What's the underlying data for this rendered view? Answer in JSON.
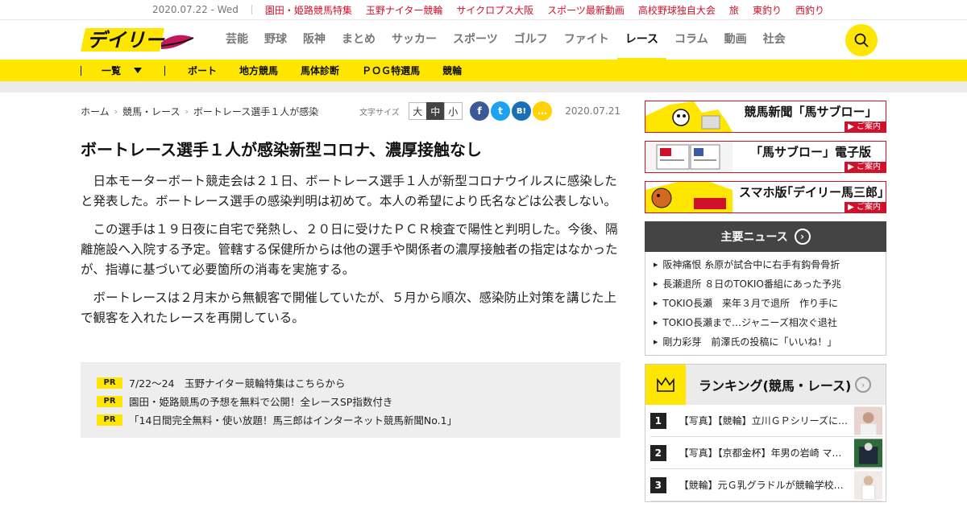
{
  "topbar": {
    "date": "2020.07.22 - Wed",
    "links": [
      "園田・姫路競馬特集",
      "玉野ナイター競輪",
      "サイクロプス大阪",
      "スポーツ最新動画",
      "高校野球独自大会",
      "旅",
      "東釣り",
      "西釣り"
    ]
  },
  "header": {
    "logo_text": "デイリー",
    "nav": [
      "芸能",
      "野球",
      "阪神",
      "まとめ",
      "サッカー",
      "スポーツ",
      "ゴルフ",
      "ファイト",
      "レース",
      "コラム",
      "動画",
      "社会"
    ],
    "active_nav": "レース"
  },
  "subnav": {
    "all_label": "一覧",
    "items": [
      "ボート",
      "地方競馬",
      "馬体診断",
      "ＰＯＧ特選馬",
      "競輪"
    ]
  },
  "breadcrumb": [
    "ホーム",
    "競馬・レース",
    "ボートレース選手１人が感染"
  ],
  "fontsize": {
    "label": "文字サイズ",
    "options": [
      "大",
      "中",
      "小"
    ],
    "selected": "中"
  },
  "share": {
    "facebook": "f",
    "twitter": "t",
    "hatena": "B!",
    "line": "…"
  },
  "article": {
    "date": "2020.07.21",
    "title": "ボートレース選手１人が感染新型コロナ、濃厚接触なし",
    "paragraphs": [
      "日本モーターボート競走会は２１日、ボートレース選手１人が新型コロナウイルスに感染したと発表した。ボートレース選手の感染判明は初めて。本人の希望により氏名などは公表しない。",
      "この選手は１９日夜に自宅で発熱し、２０日に受けたＰＣＲ検査で陽性と判明した。今後、隔離施設へ入院する予定。管轄する保健所からは他の選手や関係者の濃厚接触者の指定はなかったが、指導に基づいて必要箇所の消毒を実施する。",
      "ボートレースは２月末から無観客で開催していたが、５月から順次、感染防止対策を講じた上で観客を入れたレースを再開している。"
    ]
  },
  "pr": {
    "badge": "PR",
    "items": [
      "7/22～24　玉野ナイター競輪特集はこちらから",
      "園田・姫路競馬の予想を無料で公開！全レースSP指数付き",
      "「14日間完全無料・使い放題！馬三郎はインターネット競馬新聞No.1」"
    ]
  },
  "sidebar": {
    "banners": [
      {
        "title": "競馬新聞「馬サブロー」",
        "cta": "▶ ご案内"
      },
      {
        "title": "「馬サブロー」電子版",
        "cta": "▶ ご案内"
      },
      {
        "title": "スマホ版｢デイリー馬三郎｣",
        "cta": "▶ ご案内"
      }
    ],
    "news": {
      "heading": "主要ニュース",
      "items": [
        "阪神痛恨 糸原が試合中に右手有鈎骨骨折",
        "長瀬退所 ８日のTOKIO番組にあった予兆",
        "TOKIO長瀬　来年３月で退所　作り手に",
        "TOKIO長瀬まで…ジャニーズ相次ぐ退社",
        "剛力彩芽　前澤氏の投稿に「いいね！」"
      ]
    },
    "ranking": {
      "heading": "ランキング(競馬・レース)",
      "items": [
        {
          "rank": "1",
          "text": "【写真】【競輪】立川ＧＰシリーズに…"
        },
        {
          "rank": "2",
          "text": "【写真】【京都金杯】年男の岩崎 マ…"
        },
        {
          "rank": "3",
          "text": "【競輪】元Ｇ乳グラドルが競輪学校合…"
        }
      ]
    }
  },
  "colors": {
    "brand_yellow": "#ffe600",
    "accent_red": "#d0112b",
    "dark": "#444444"
  }
}
